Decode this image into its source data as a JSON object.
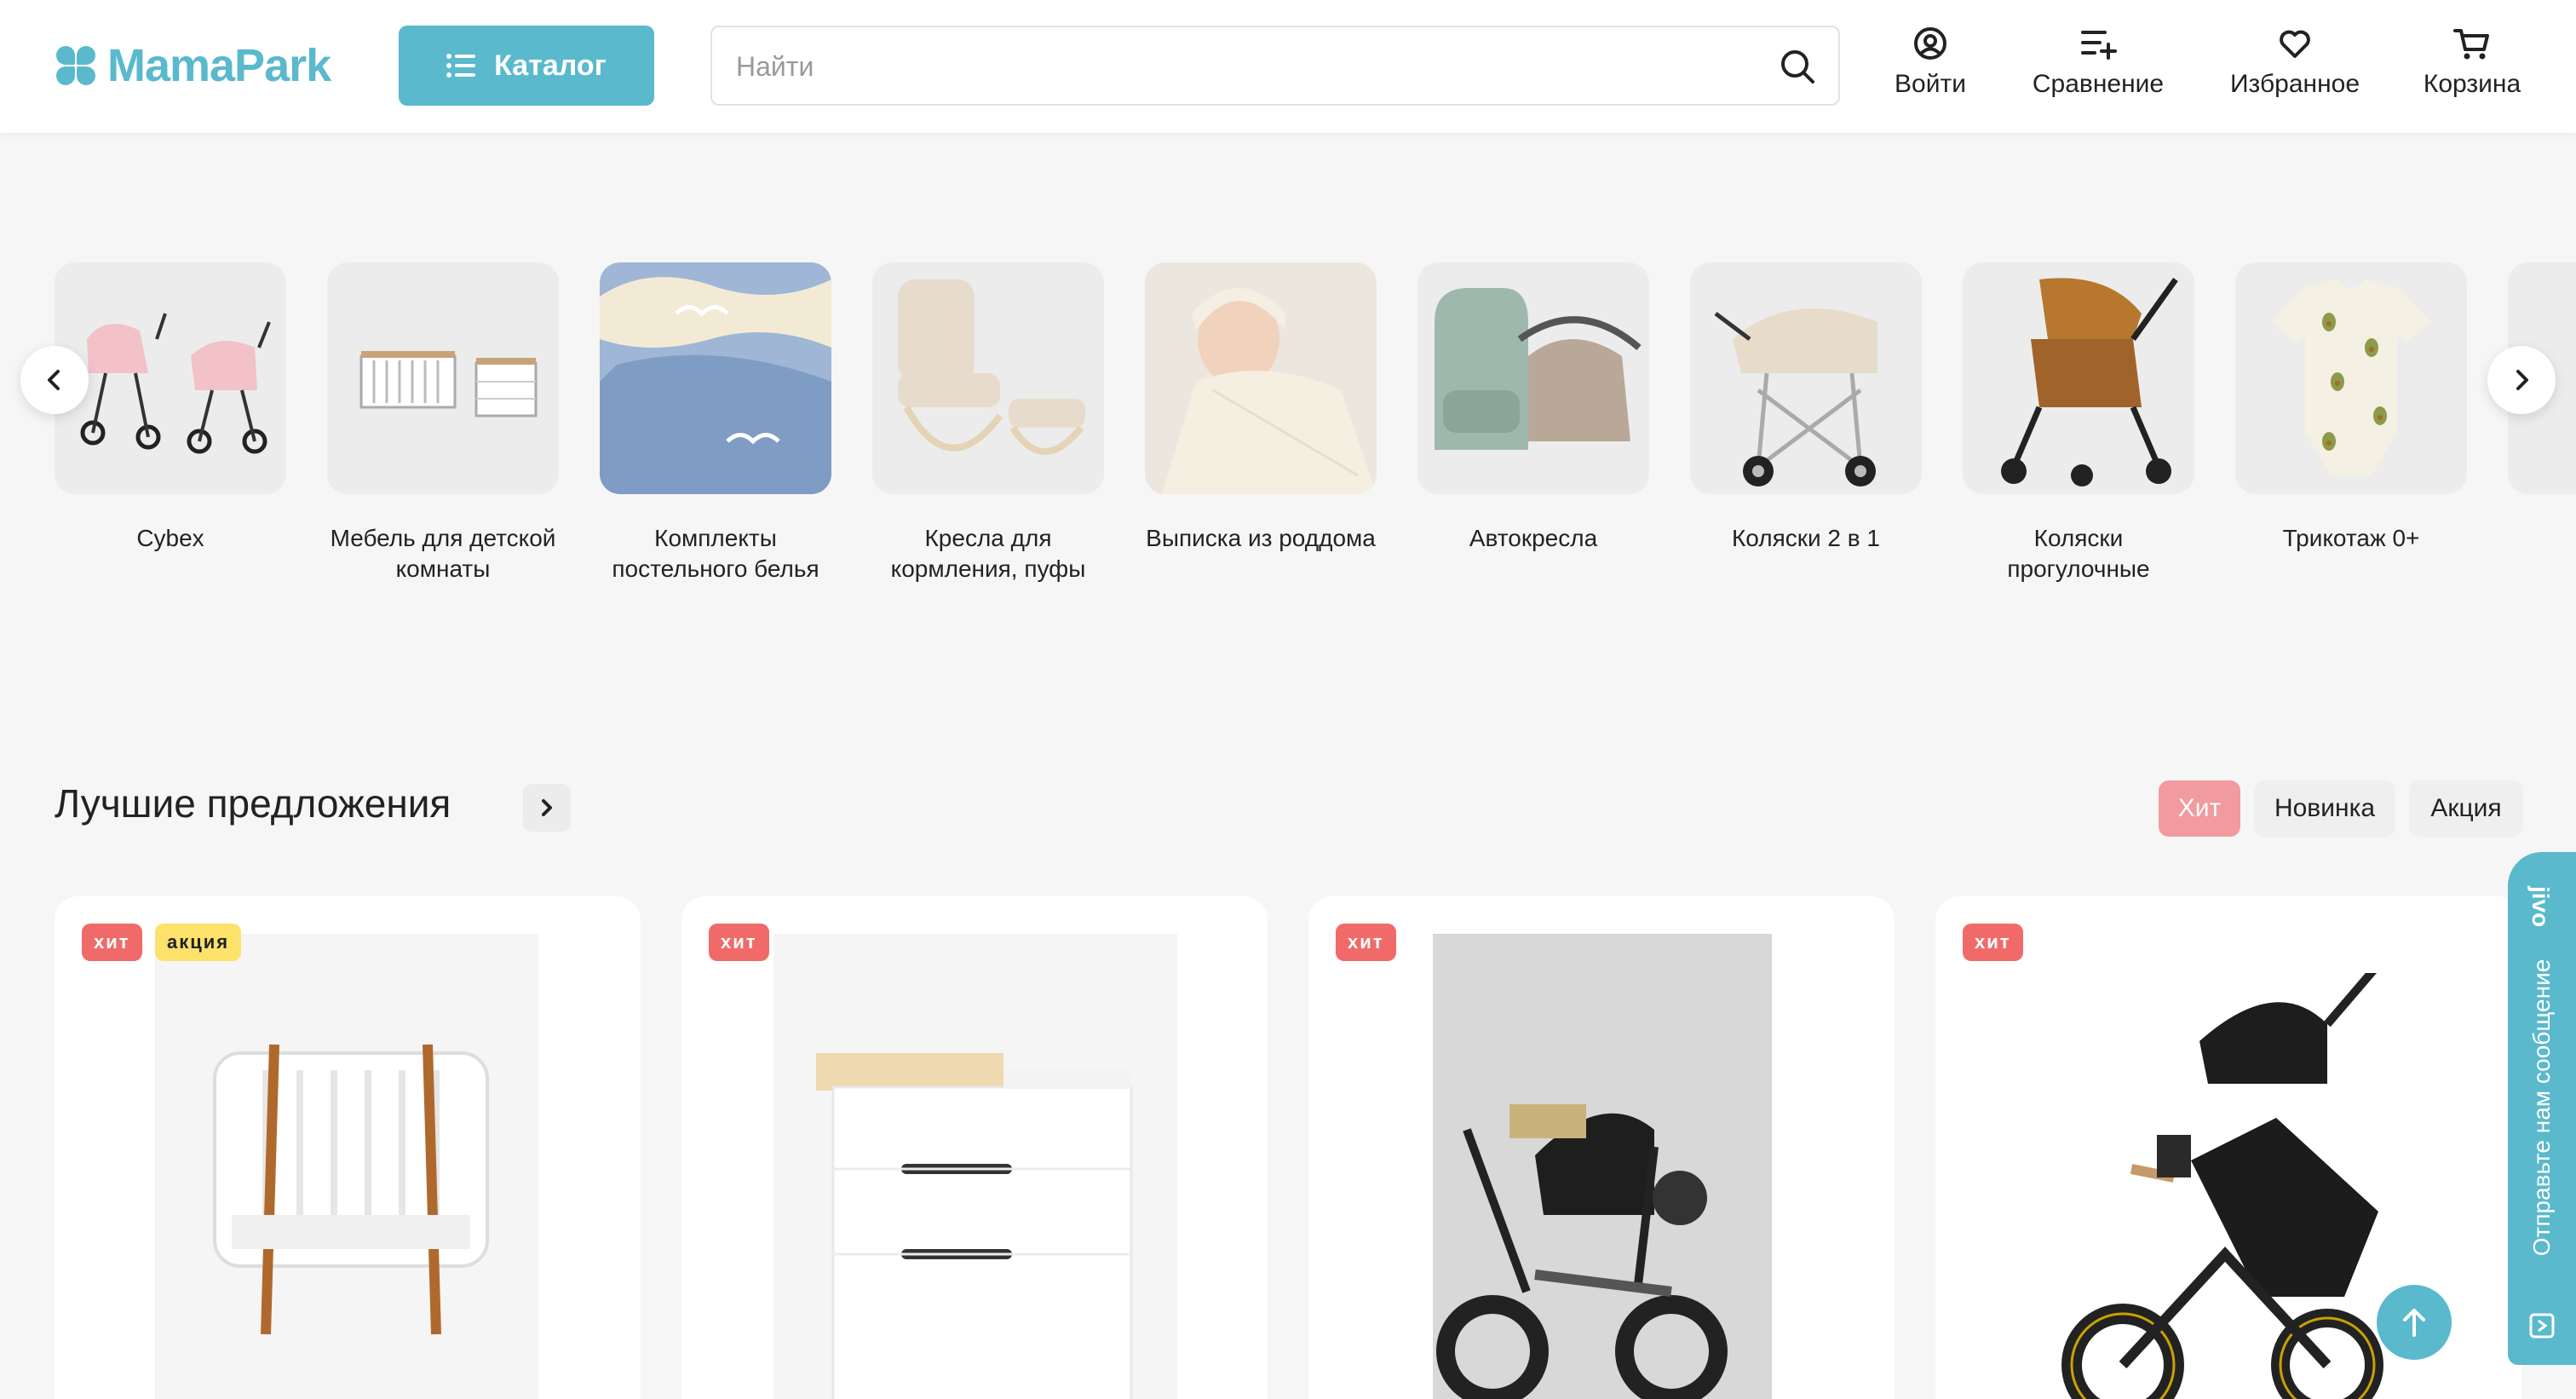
{
  "header": {
    "logo_text": "MamaPark",
    "catalog_label": "Каталог",
    "search_placeholder": "Найти",
    "actions": [
      {
        "label": "Войти",
        "icon": "user-icon"
      },
      {
        "label": "Сравнение",
        "icon": "compare-icon"
      },
      {
        "label": "Избранное",
        "icon": "heart-icon"
      },
      {
        "label": "Корзина",
        "icon": "cart-icon"
      }
    ]
  },
  "categories": [
    {
      "name": "Cybex"
    },
    {
      "name": "Мебель для детской комнаты"
    },
    {
      "name": "Комплекты постельного белья"
    },
    {
      "name": "Кресла для кормления, пуфы"
    },
    {
      "name": "Выписка из роддома"
    },
    {
      "name": "Автокресла"
    },
    {
      "name": "Коляски 2 в 1"
    },
    {
      "name": "Коляски прогулочные"
    },
    {
      "name": "Трикотаж 0+"
    }
  ],
  "best_offers": {
    "title": "Лучшие предложения",
    "tabs": [
      {
        "label": "Хит",
        "active": true
      },
      {
        "label": "Новинка",
        "active": false
      },
      {
        "label": "Акция",
        "active": false
      }
    ],
    "products": [
      {
        "badges": [
          "хит",
          "акция"
        ],
        "image": "crib-image"
      },
      {
        "badges": [
          "хит"
        ],
        "image": "changing-dresser-image"
      },
      {
        "badges": [
          "хит"
        ],
        "image": "tricycle-image"
      },
      {
        "badges": [
          "хит"
        ],
        "image": "folding-tricycle-image"
      }
    ]
  },
  "jivo": {
    "label": "Отправьте нам сообщение",
    "brand": "jivo"
  },
  "colors": {
    "accent": "#5ab9cc",
    "hit": "#f16a6a",
    "sale": "#fce16b",
    "active_tab": "#f19aa0"
  }
}
